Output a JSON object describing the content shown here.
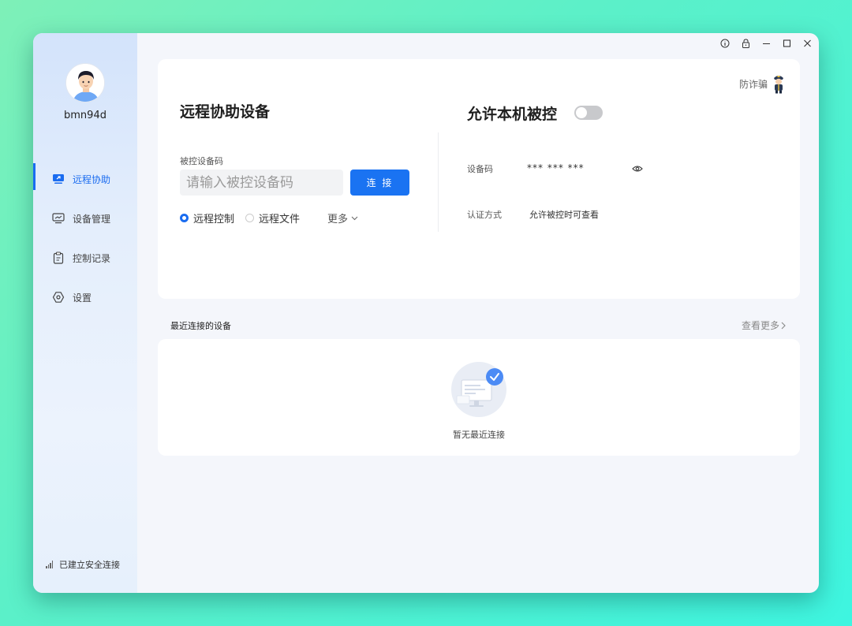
{
  "user": {
    "name": "bmn94d"
  },
  "nav": {
    "items": [
      {
        "label": "远程协助",
        "icon": "remote-assist-icon",
        "active": true
      },
      {
        "label": "设备管理",
        "icon": "monitor-icon",
        "active": false
      },
      {
        "label": "控制记录",
        "icon": "clipboard-icon",
        "active": false
      },
      {
        "label": "设置",
        "icon": "settings-hexagon-icon",
        "active": false
      }
    ]
  },
  "status": {
    "text": "已建立安全连接"
  },
  "titlebar": {
    "icons": [
      "info-icon",
      "lock-icon",
      "minimize-icon",
      "maximize-icon",
      "close-icon"
    ]
  },
  "remote": {
    "title": "远程协助设备",
    "code_label": "被控设备码",
    "code_placeholder": "请输入被控设备码",
    "connect_label": "连 接",
    "options": [
      {
        "label": "远程控制",
        "selected": true
      },
      {
        "label": "远程文件",
        "selected": false
      }
    ],
    "more_label": "更多"
  },
  "local": {
    "title": "允许本机被控",
    "toggle_on": false,
    "anti_fraud_label": "防诈骗",
    "device_code_label": "设备码",
    "device_code_value": "*** *** ***",
    "auth_label": "认证方式",
    "auth_value": "允许被控时可查看"
  },
  "recent": {
    "title": "最近连接的设备",
    "see_more": "查看更多",
    "empty_text": "暂无最近连接"
  },
  "colors": {
    "accent": "#1a6cf0",
    "button": "#1a73f2",
    "toggle_off": "#c8c9cc"
  }
}
